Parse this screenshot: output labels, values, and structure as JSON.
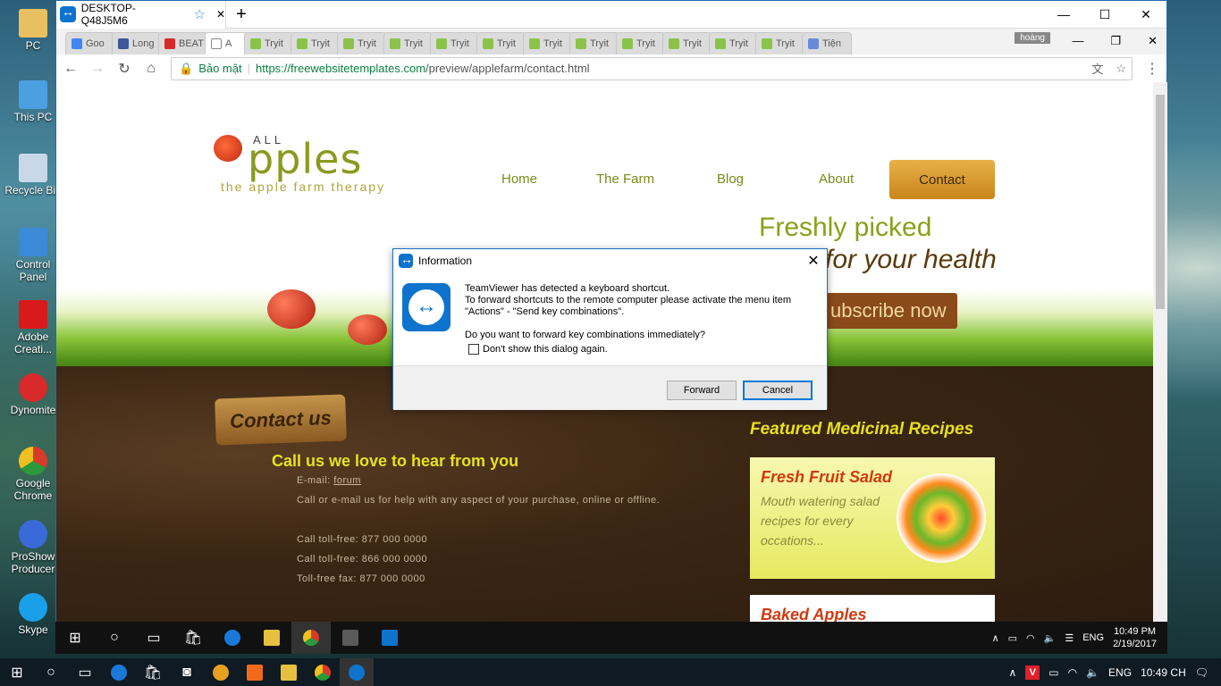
{
  "desktop_icons": [
    {
      "label": "PC",
      "color": "#e8c060"
    },
    {
      "label": "This PC",
      "color": "#4aa0e0"
    },
    {
      "label": "Recycle Bin",
      "color": "#c8d8e8"
    },
    {
      "label": "Control Panel",
      "color": "#3a8ad8"
    },
    {
      "label": "Adobe Creati...",
      "color": "#d81a1a"
    },
    {
      "label": "Dynomite",
      "color": "#d82a2a"
    },
    {
      "label": "Google Chrome",
      "color": "#2a9a3a"
    },
    {
      "label": "ProShow Producer",
      "color": "#3a6ad8"
    },
    {
      "label": "Skype",
      "color": "#1aa0e8"
    }
  ],
  "remote_window": {
    "tab_title": "DESKTOP-Q48J5M6",
    "star": "☆",
    "close": "✕",
    "plus": "+",
    "min": "—",
    "max": "☐",
    "close_win": "✕"
  },
  "chrome": {
    "tabs": [
      "Goo",
      "Long",
      "BEAT",
      "A",
      "Tryit",
      "Tryit",
      "Tryit",
      "Tryit",
      "Tryit",
      "Tryit",
      "Tryit",
      "Tryit",
      "Tryit",
      "Tryit",
      "Tryit",
      "Tryit",
      "Tiện"
    ],
    "user": "hoàng",
    "secure_label": "Bảo mật",
    "url_host": "https://freewebsitetemplates.com",
    "url_path": "/preview/applefarm/contact.html",
    "min": "—",
    "max": "❐",
    "close": "✕"
  },
  "site": {
    "logo_all": "ALL",
    "logo_pples": "pples",
    "logo_tagline": "the apple farm therapy",
    "nav": [
      "Home",
      "The Farm",
      "Blog",
      "About",
      "Contact"
    ],
    "fresh": "Freshly picked",
    "health": "for your health",
    "subscribe": "ubscribe now",
    "contact_sign": "Contact us",
    "call_heading": "Call us we love to hear from you",
    "email_label": "E-mail:",
    "email_link": "forum",
    "call_desc": "Call or e-mail us for help with any aspect of your purchase, online or offline.",
    "toll1": "Call toll-free: 877 000 0000",
    "toll2": "Call toll-free: 866 000 0000",
    "fax": "Toll-free fax: 877 000 0000",
    "featured": "Featured Medicinal Recipes",
    "recipe1_title": "Fresh Fruit Salad",
    "recipe1_desc": "Mouth watering salad recipes for every occations...",
    "recipe2_title": "Baked Apples"
  },
  "dialog": {
    "title": "Information",
    "msg1": "TeamViewer has detected a keyboard shortcut.",
    "msg2": "To forward shortcuts to the remote computer please activate the menu item \"Actions\" - \"Send key combinations\".",
    "question": "Do you want to forward key combinations immediately?",
    "checkbox": "Don't show this dialog again.",
    "forward": "Forward",
    "cancel": "Cancel"
  },
  "remote_taskbar": {
    "lang": "ENG",
    "time": "10:49 PM",
    "date": "2/19/2017"
  },
  "local_taskbar": {
    "lang": "ENG",
    "time": "10:49 CH"
  }
}
